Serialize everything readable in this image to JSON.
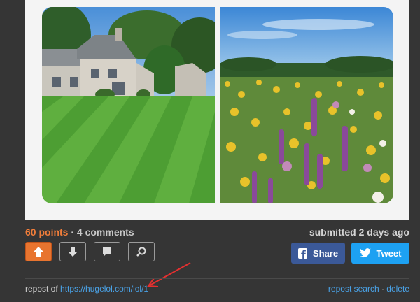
{
  "post": {
    "points": "60 points",
    "separator": " · ",
    "comments": "4 comments",
    "submitted": "submitted 2 days ago"
  },
  "actions": {
    "upvote_icon": "arrow-up-icon",
    "downvote_icon": "arrow-down-icon",
    "comment_icon": "comment-icon",
    "zoom_icon": "zoom-icon"
  },
  "share": {
    "facebook_label": "Share",
    "twitter_label": "Tweet"
  },
  "footer": {
    "repost_prefix": "repost of ",
    "repost_link": "https://hugelol.com/lol/1",
    "repost_search": "repost search",
    "separator": " · ",
    "delete": "delete"
  },
  "colors": {
    "points": "#f07d3a",
    "facebook": "#3b5998",
    "twitter": "#1da1f2",
    "link": "#4aa3e8",
    "annotation_arrow": "#e53030"
  }
}
